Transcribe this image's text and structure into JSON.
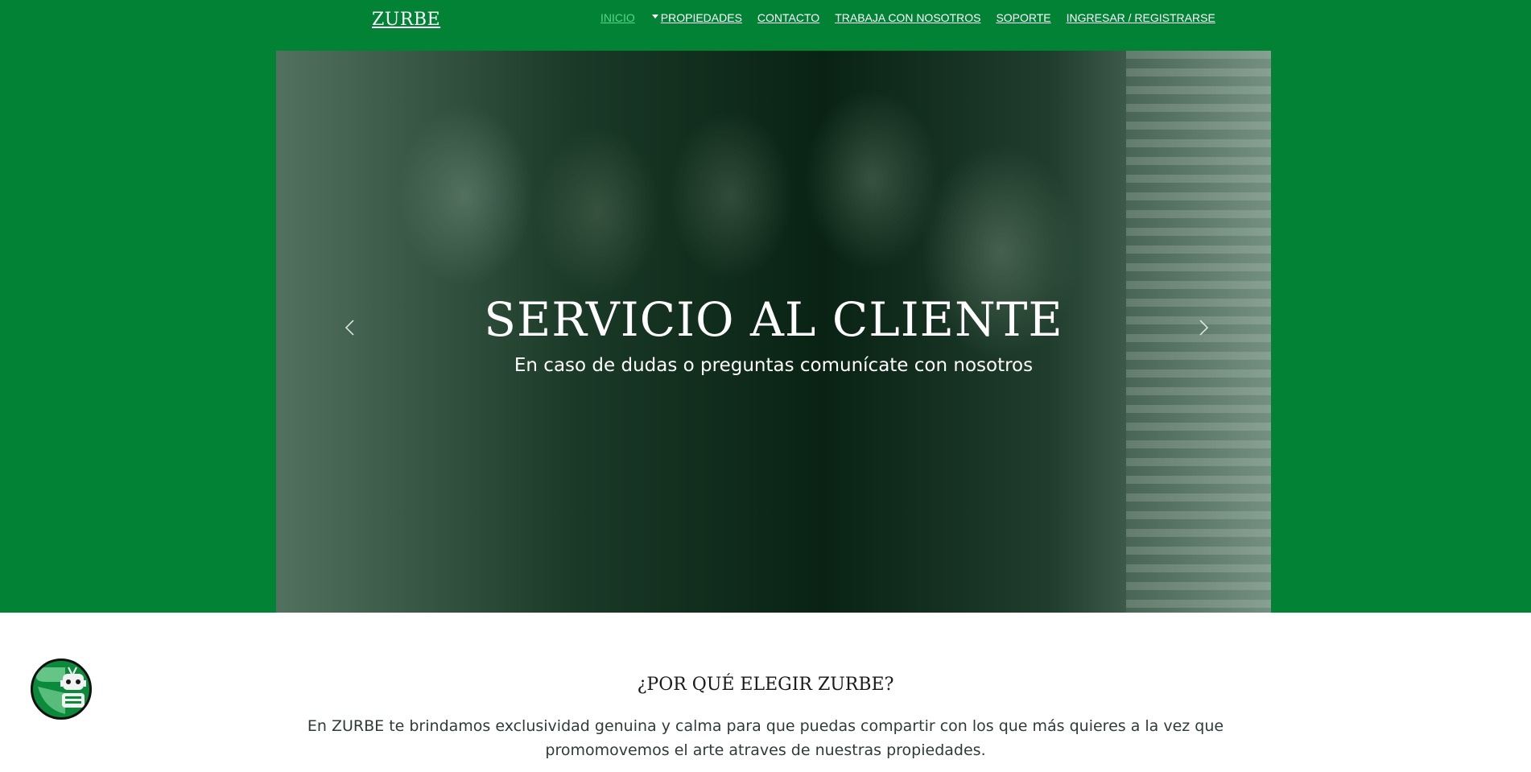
{
  "header": {
    "brand": "ZURBE",
    "nav": {
      "inicio": "INICIO",
      "propiedades": "PROPIEDADES",
      "contacto": "CONTACTO",
      "trabaja": "TRABAJA CON NOSOTROS",
      "soporte": "SOPORTE",
      "ingresar": "INGRESAR / REGISTRARSE"
    }
  },
  "hero": {
    "title": "SERVICIO AL CLIENTE",
    "subtitle": "En caso de dudas o preguntas comunícate con nosotros"
  },
  "section": {
    "title": "¿POR QUÉ ELEGIR ZURBE?",
    "text": "En ZURBE te brindamos exclusividad genuina y calma para que puedas compartir con los que más quieres a la vez que promomovemos el arte atraves de nuestras propiedades."
  },
  "colors": {
    "brand_green": "#018235",
    "active_link": "#5fd38a"
  },
  "icons": {
    "prev": "chevron-left-icon",
    "next": "chevron-right-icon",
    "chatbot": "robot-chat-icon",
    "dropdown": "caret-down-icon"
  }
}
